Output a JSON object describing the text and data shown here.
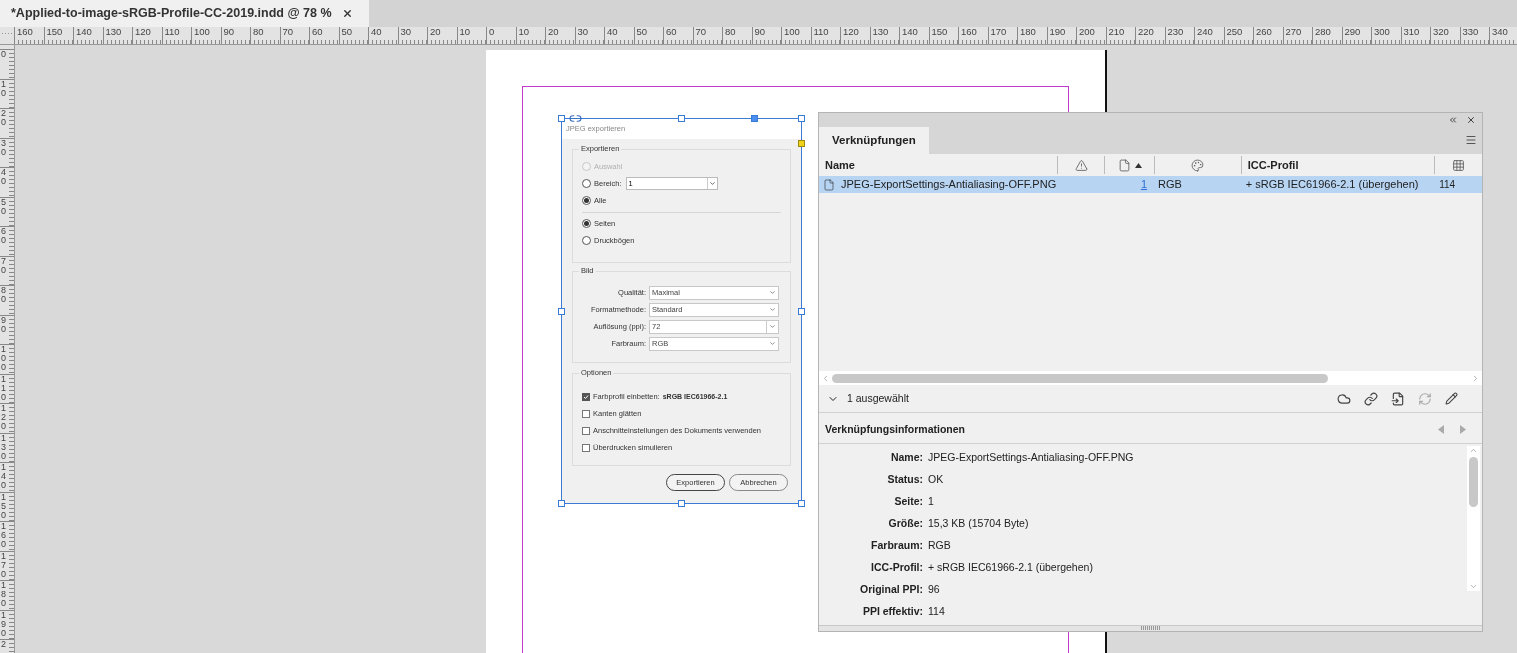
{
  "document_tab": {
    "title": "*Applied-to-image-sRGB-Profile-CC-2019.indd @ 78 %",
    "selected": true
  },
  "ruler": {
    "horizontal": [
      "160",
      "150",
      "140",
      "130",
      "120",
      "110",
      "100",
      "90",
      "80",
      "70",
      "60",
      "50",
      "40",
      "30",
      "20",
      "10",
      "0",
      "10",
      "20",
      "30",
      "40",
      "50",
      "60",
      "70",
      "80",
      "90",
      "100",
      "110",
      "120",
      "130",
      "140",
      "150",
      "160",
      "170",
      "180",
      "190",
      "200",
      "210",
      "220",
      "230",
      "240",
      "250",
      "260",
      "270",
      "280",
      "290",
      "300",
      "310",
      "320",
      "330",
      "340"
    ],
    "vertical": [
      "0",
      "10",
      "20",
      "30",
      "40",
      "50",
      "60",
      "70",
      "80",
      "90",
      "100",
      "110",
      "120",
      "130",
      "140",
      "150",
      "160",
      "170",
      "180",
      "190",
      "2"
    ]
  },
  "placed_image": {
    "kind": "screenshot",
    "dialog": {
      "title": "JPEG exportieren",
      "export_group": {
        "title": "Exportieren",
        "sets": [
          [
            {
              "label": "Auswahl",
              "selected": false,
              "disabled": true
            },
            {
              "label": "Bereich:",
              "selected": false,
              "disabled": false,
              "value": "1"
            },
            {
              "label": "Alle",
              "selected": true,
              "disabled": false
            }
          ],
          [
            {
              "label": "Seiten",
              "selected": true,
              "disabled": false
            },
            {
              "label": "Druckbögen",
              "selected": false,
              "disabled": false
            }
          ]
        ]
      },
      "image_group": {
        "title": "Bild",
        "fields": [
          {
            "label": "Qualität:",
            "value": "Maximal",
            "kind": "select"
          },
          {
            "label": "Formatmethode:",
            "value": "Standard",
            "kind": "select"
          },
          {
            "label": "Auflösung (ppi):",
            "value": "72",
            "kind": "combo"
          },
          {
            "label": "Farbraum:",
            "value": "RGB",
            "kind": "select"
          }
        ]
      },
      "options_group": {
        "title": "Optionen",
        "checkboxes": [
          {
            "label": "Farbprofil einbetten:",
            "detail": "sRGB IEC61966-2.1",
            "checked": true
          },
          {
            "label": "Kanten glätten",
            "checked": false
          },
          {
            "label": "Anschnitteinstellungen des Dokuments verwenden",
            "checked": false
          },
          {
            "label": "Überdrucken simulieren",
            "checked": false
          }
        ]
      },
      "buttons": [
        {
          "label": "Exportieren",
          "default": true
        },
        {
          "label": "Abbrechen",
          "default": false
        }
      ]
    }
  },
  "links_panel": {
    "tabs": [
      {
        "label": "Verknüpfungen",
        "selected": true
      }
    ],
    "columns": [
      {
        "kind": "text",
        "label": "Name",
        "sorted": false
      },
      {
        "kind": "icon",
        "sorted": false
      },
      {
        "kind": "icon",
        "sorted": true
      },
      {
        "kind": "icon",
        "sorted": false
      },
      {
        "kind": "text",
        "label": "ICC-Profil",
        "sorted": false
      },
      {
        "kind": "icon",
        "sorted": false
      }
    ],
    "rows": [
      {
        "name": "JPEG-ExportSettings-Antialiasing-OFF.PNG",
        "page": "1",
        "color_space": "RGB",
        "icc_profile": "+ sRGB IEC61966-2.1 (übergehen)",
        "column_6": "114",
        "selected": true
      }
    ],
    "selection_summary": "1 ausgewählt",
    "info": {
      "title": "Verknüpfungsinformationen",
      "fields": [
        {
          "label": "Name:",
          "value": "JPEG-ExportSettings-Antialiasing-OFF.PNG"
        },
        {
          "label": "Status:",
          "value": "OK"
        },
        {
          "label": "Seite:",
          "value": "1"
        },
        {
          "label": "Größe:",
          "value": "15,3 KB (15704 Byte)"
        },
        {
          "label": "Farbraum:",
          "value": "RGB"
        },
        {
          "label": "ICC-Profil:",
          "value": "+ sRGB IEC61966-2.1 (übergehen)"
        },
        {
          "label": "Original PPI:",
          "value": "96"
        },
        {
          "label": "PPI effektiv:",
          "value": "114"
        }
      ]
    }
  }
}
